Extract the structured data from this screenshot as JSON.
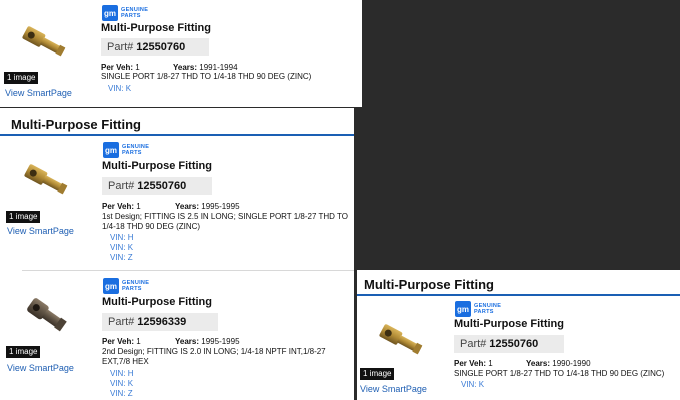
{
  "panel_a": {
    "image_badge": "1 image",
    "smartpage_link": "View SmartPage",
    "brand_line1": "GENUINE",
    "brand_line2": "PARTS",
    "gm_mark": "gm",
    "part_name": "Multi-Purpose Fitting",
    "part_label": "Part#",
    "part_number": "12550760",
    "per_veh_label": "Per Veh:",
    "per_veh": "1",
    "years_label": "Years:",
    "years": "1991-1994",
    "description": "SINGLE PORT 1/8-27 THD TO 1/4-18 THD 90 DEG (ZINC)",
    "vins": [
      "VIN: K"
    ]
  },
  "panel_b": {
    "section_title": "Multi-Purpose Fitting",
    "items": [
      {
        "image_badge": "1 image",
        "smartpage_link": "View SmartPage",
        "brand_line1": "GENUINE",
        "brand_line2": "PARTS",
        "gm_mark": "gm",
        "part_name": "Multi-Purpose Fitting",
        "part_label": "Part#",
        "part_number": "12550760",
        "per_veh_label": "Per Veh:",
        "per_veh": "1",
        "years_label": "Years:",
        "years": "1995-1995",
        "description_line1": "1st Design; FITTING IS 2.5 IN LONG; SINGLE PORT 1/8-27 THD TO",
        "description_line2": "1/4-18 THD 90 DEG (ZINC)",
        "vins": [
          "VIN: H",
          "VIN: K",
          "VIN: Z"
        ]
      },
      {
        "image_badge": "1 image",
        "smartpage_link": "View SmartPage",
        "brand_line1": "GENUINE",
        "brand_line2": "PARTS",
        "gm_mark": "gm",
        "part_name": "Multi-Purpose Fitting",
        "part_label": "Part#",
        "part_number": "12596339",
        "per_veh_label": "Per Veh:",
        "per_veh": "1",
        "years_label": "Years:",
        "years": "1995-1995",
        "description_line1": "2nd Design; FITTING IS 2.0 IN LONG; 1/4-18 NPTF INT,1/8-27",
        "description_line2": "EXT,7/8 HEX",
        "vins": [
          "VIN: H",
          "VIN: K",
          "VIN: Z"
        ]
      }
    ]
  },
  "panel_c": {
    "section_title": "Multi-Purpose Fitting",
    "image_badge": "1 image",
    "smartpage_link": "View SmartPage",
    "brand_line1": "GENUINE",
    "brand_line2": "PARTS",
    "gm_mark": "gm",
    "part_name": "Multi-Purpose Fitting",
    "part_label": "Part#",
    "part_number": "12550760",
    "per_veh_label": "Per Veh:",
    "per_veh": "1",
    "years_label": "Years:",
    "years": "1990-1990",
    "description": "SINGLE PORT 1/8-27 THD TO 1/4-18 THD 90 DEG (ZINC)",
    "vins": [
      "VIN: K"
    ]
  },
  "colors": {
    "link": "#1f5fb3",
    "vin": "#3a7bd5",
    "gm_brand": "#1a6ee0",
    "title_rule": "#1a5fb4",
    "part_box": "#ebebeb"
  }
}
